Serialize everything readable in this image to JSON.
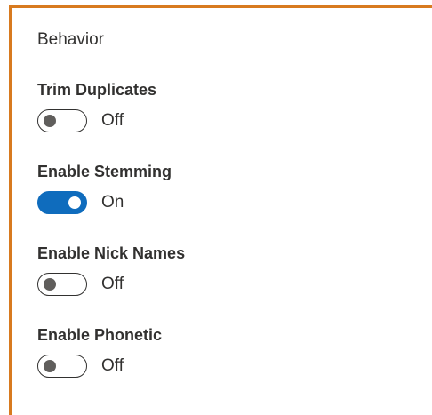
{
  "section": {
    "title": "Behavior"
  },
  "settings": [
    {
      "label": "Trim Duplicates",
      "state": "Off",
      "on": false
    },
    {
      "label": "Enable Stemming",
      "state": "On",
      "on": true
    },
    {
      "label": "Enable Nick Names",
      "state": "Off",
      "on": false
    },
    {
      "label": "Enable Phonetic",
      "state": "Off",
      "on": false
    }
  ],
  "colors": {
    "accent": "#d87a1f",
    "toggle_on": "#0f6cbd",
    "text": "#323130"
  }
}
